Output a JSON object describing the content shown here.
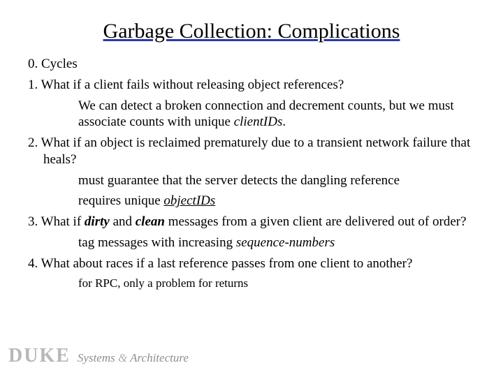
{
  "title": "Garbage Collection: Complications",
  "items": {
    "i0": "0. Cycles",
    "i1": "1. What if a client fails without releasing object references?",
    "i1sub_a": "We can detect a broken connection and decrement counts, but we must associate counts with unique ",
    "i1sub_b": "clientIDs",
    "i1sub_c": ".",
    "i2": "2. What if an object is reclaimed prematurely due to a transient network failure that heals?",
    "i2sub1": "must guarantee that the server detects the dangling reference",
    "i2sub2_a": "requires unique ",
    "i2sub2_b": "objectIDs",
    "i3_a": "3. What if ",
    "i3_b": "dirty",
    "i3_c": " and ",
    "i3_d": "clean",
    "i3_e": " messages from a given client are delivered out of order?",
    "i3sub_a": "tag messages with increasing ",
    "i3sub_b": "sequence-numbers",
    "i4": "4. What about races if a last reference passes from one client to another?",
    "i4sub": "for RPC, only a problem for returns"
  },
  "footer": {
    "duke": "DUKE",
    "systems": "Systems",
    "amp": "&",
    "arch": "Architecture"
  }
}
